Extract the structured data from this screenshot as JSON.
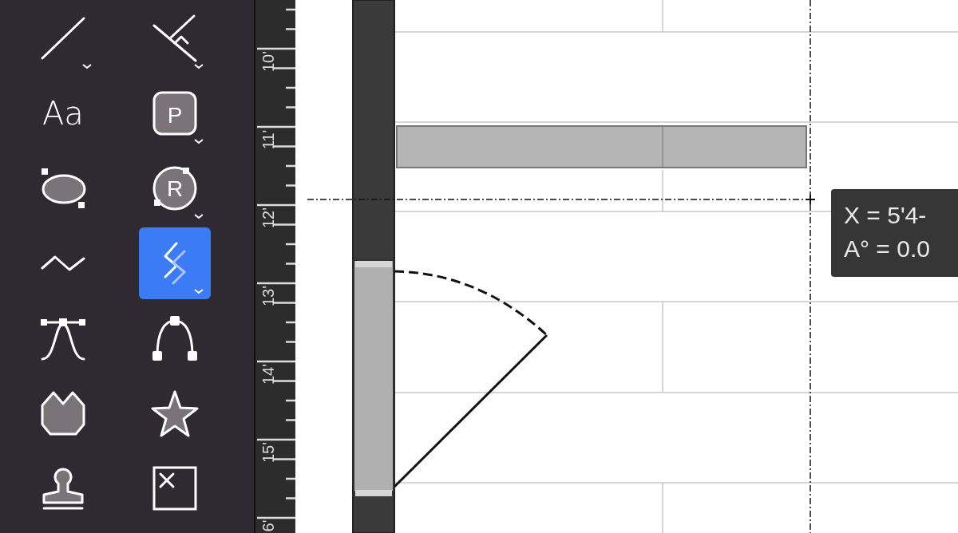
{
  "toolbar": {
    "tools": [
      {
        "kind": "line",
        "selected": false,
        "menu": true
      },
      {
        "kind": "perpendicular",
        "selected": false,
        "menu": true
      },
      {
        "kind": "text",
        "label": "Aa",
        "selected": false,
        "menu": false
      },
      {
        "kind": "badge",
        "label": "P",
        "selected": false,
        "menu": true
      },
      {
        "kind": "ellipse",
        "selected": false,
        "menu": false
      },
      {
        "kind": "circle",
        "label": "R",
        "selected": false,
        "menu": true
      },
      {
        "kind": "polyline",
        "selected": false,
        "menu": false
      },
      {
        "kind": "wall",
        "selected": true,
        "menu": true
      },
      {
        "kind": "bezier",
        "selected": false,
        "menu": false
      },
      {
        "kind": "arc",
        "selected": false,
        "menu": false
      },
      {
        "kind": "polygon",
        "selected": false,
        "menu": false
      },
      {
        "kind": "star",
        "selected": false,
        "menu": false
      },
      {
        "kind": "stamp",
        "selected": false,
        "menu": false
      },
      {
        "kind": "placeholder",
        "selected": false,
        "menu": false
      }
    ]
  },
  "ruler": {
    "labels": [
      "10'",
      "11'",
      "12'",
      "13'",
      "14'",
      "15'",
      "6'"
    ]
  },
  "tooltip": {
    "lines": [
      "X = 5'4-",
      "A° = 0.0"
    ]
  }
}
